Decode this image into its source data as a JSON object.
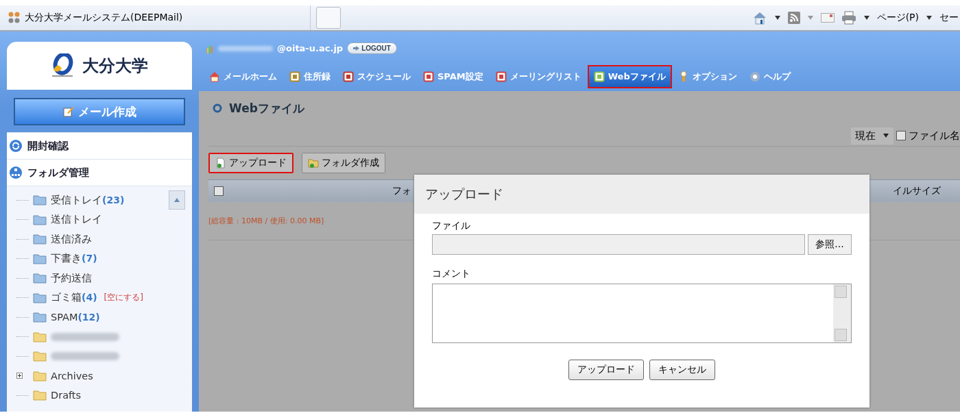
{
  "browser": {
    "tab_title": "大分大学メールシステム(DEEPMail)",
    "menu_page": "ページ(P)",
    "menu_cut": "セー"
  },
  "sidebar": {
    "logo_text": "大分大学",
    "compose": "メール作成",
    "read_receipt": "開封確認",
    "folder_manage": "フォルダ管理",
    "folders": [
      {
        "kind": "system",
        "name": "受信トレイ",
        "count": "(23)"
      },
      {
        "kind": "system",
        "name": "送信トレイ"
      },
      {
        "kind": "system",
        "name": "送信済み"
      },
      {
        "kind": "system",
        "name": "下書き",
        "count": "(7)"
      },
      {
        "kind": "system",
        "name": "予約送信"
      },
      {
        "kind": "system",
        "name": "ゴミ箱",
        "count": "(4)",
        "action": "[空にする]"
      },
      {
        "kind": "system",
        "name": "SPAM",
        "count": "(12)"
      },
      {
        "kind": "redacted"
      },
      {
        "kind": "redacted"
      },
      {
        "kind": "user",
        "name": "Archives",
        "expandable": true
      },
      {
        "kind": "user",
        "name": "Drafts"
      }
    ]
  },
  "user": {
    "email_domain": "@oita-u.ac.jp",
    "logout": "LOGOUT"
  },
  "nav": [
    {
      "label": "メールホーム",
      "selected": false,
      "highlighted": false
    },
    {
      "label": "住所録",
      "selected": false,
      "highlighted": false
    },
    {
      "label": "スケジュール",
      "selected": false,
      "highlighted": false
    },
    {
      "label": "SPAM設定",
      "selected": false,
      "highlighted": false
    },
    {
      "label": "メーリングリスト",
      "selected": false,
      "highlighted": false
    },
    {
      "label": "Webファイル",
      "selected": true,
      "highlighted": true
    },
    {
      "label": "オプション",
      "selected": false,
      "highlighted": false
    },
    {
      "label": "ヘルプ",
      "selected": false,
      "highlighted": false
    }
  ],
  "content": {
    "title": "Webファイル",
    "filter": {
      "select": "現在",
      "checkbox_label": "ファイル名",
      "checked": false
    },
    "toolbar": [
      {
        "label": "アップロード",
        "highlighted": true
      },
      {
        "label": "フォルダ作成",
        "highlighted": false
      }
    ],
    "table": {
      "columns": [
        {
          "label": "フォ"
        },
        {
          "label": "イルサイズ"
        }
      ],
      "select_all": false
    },
    "quota": "[総容量 : 10MB / 使用: 0.00 MB]"
  },
  "dialog": {
    "title": "アップロード",
    "file_label": "ファイル",
    "browse": "参照...",
    "comment_label": "コメント",
    "buttons": [
      "アップロード",
      "キャンセル"
    ]
  }
}
